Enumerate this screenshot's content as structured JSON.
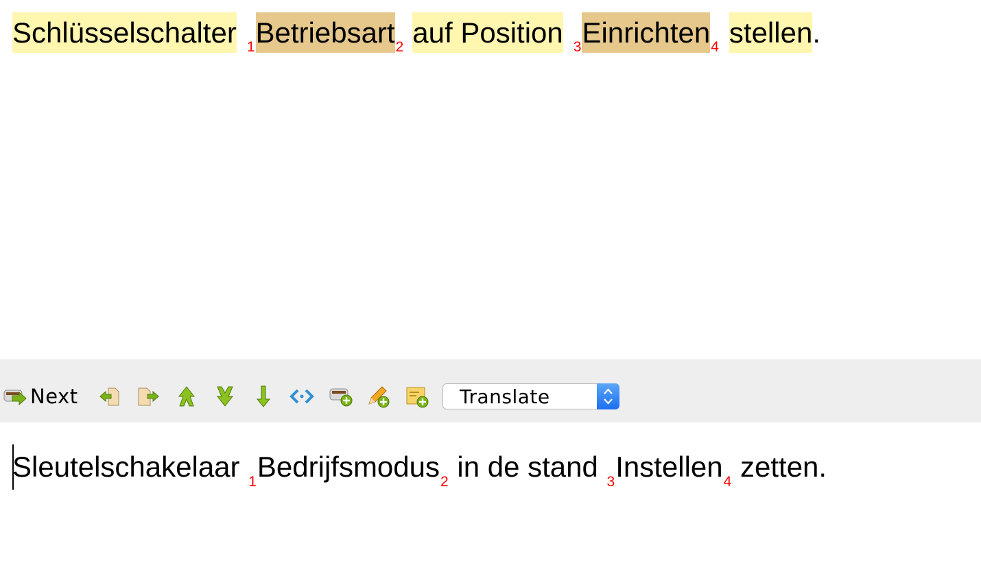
{
  "source": {
    "segments": [
      {
        "kind": "term",
        "style": "light",
        "text": "Schlüsselschalter"
      },
      {
        "kind": "tag",
        "text": "1"
      },
      {
        "kind": "term",
        "style": "dark",
        "text": "Betriebsart"
      },
      {
        "kind": "tag",
        "text": "2"
      },
      {
        "kind": "term",
        "style": "light",
        "text": "auf Position"
      },
      {
        "kind": "tag",
        "text": "3"
      },
      {
        "kind": "term",
        "style": "dark",
        "text": "Einrichten"
      },
      {
        "kind": "tag",
        "text": "4"
      },
      {
        "kind": "term",
        "style": "light",
        "text": "stellen"
      },
      {
        "kind": "text",
        "text": "."
      }
    ]
  },
  "toolbar": {
    "next_label": "Next",
    "mode_value": "Translate",
    "icons": [
      "next-icon",
      "insert-source-icon",
      "copy-source-icon",
      "previous-segment-icon",
      "next-segment-icon",
      "down-arrow-icon",
      "tags-icon",
      "add-tm-icon",
      "edit-pencil-icon",
      "add-note-icon"
    ]
  },
  "target": {
    "segments": [
      {
        "kind": "text",
        "text": "Sleutelschakelaar "
      },
      {
        "kind": "tag",
        "text": "1"
      },
      {
        "kind": "text",
        "text": "Bedrijfsmodus"
      },
      {
        "kind": "tag",
        "text": "2"
      },
      {
        "kind": "text",
        "text": " in de stand "
      },
      {
        "kind": "tag",
        "text": "3"
      },
      {
        "kind": "text",
        "text": "Instellen"
      },
      {
        "kind": "tag",
        "text": "4"
      },
      {
        "kind": "text",
        "text": " zetten."
      }
    ]
  },
  "colors": {
    "term_light": "#fff6b0",
    "term_dark": "#e6c88c",
    "tag": "#ff0000",
    "toolbar_bg": "#eeeeee",
    "icon_green": "#7ab317",
    "icon_blue": "#2f8fd8"
  }
}
